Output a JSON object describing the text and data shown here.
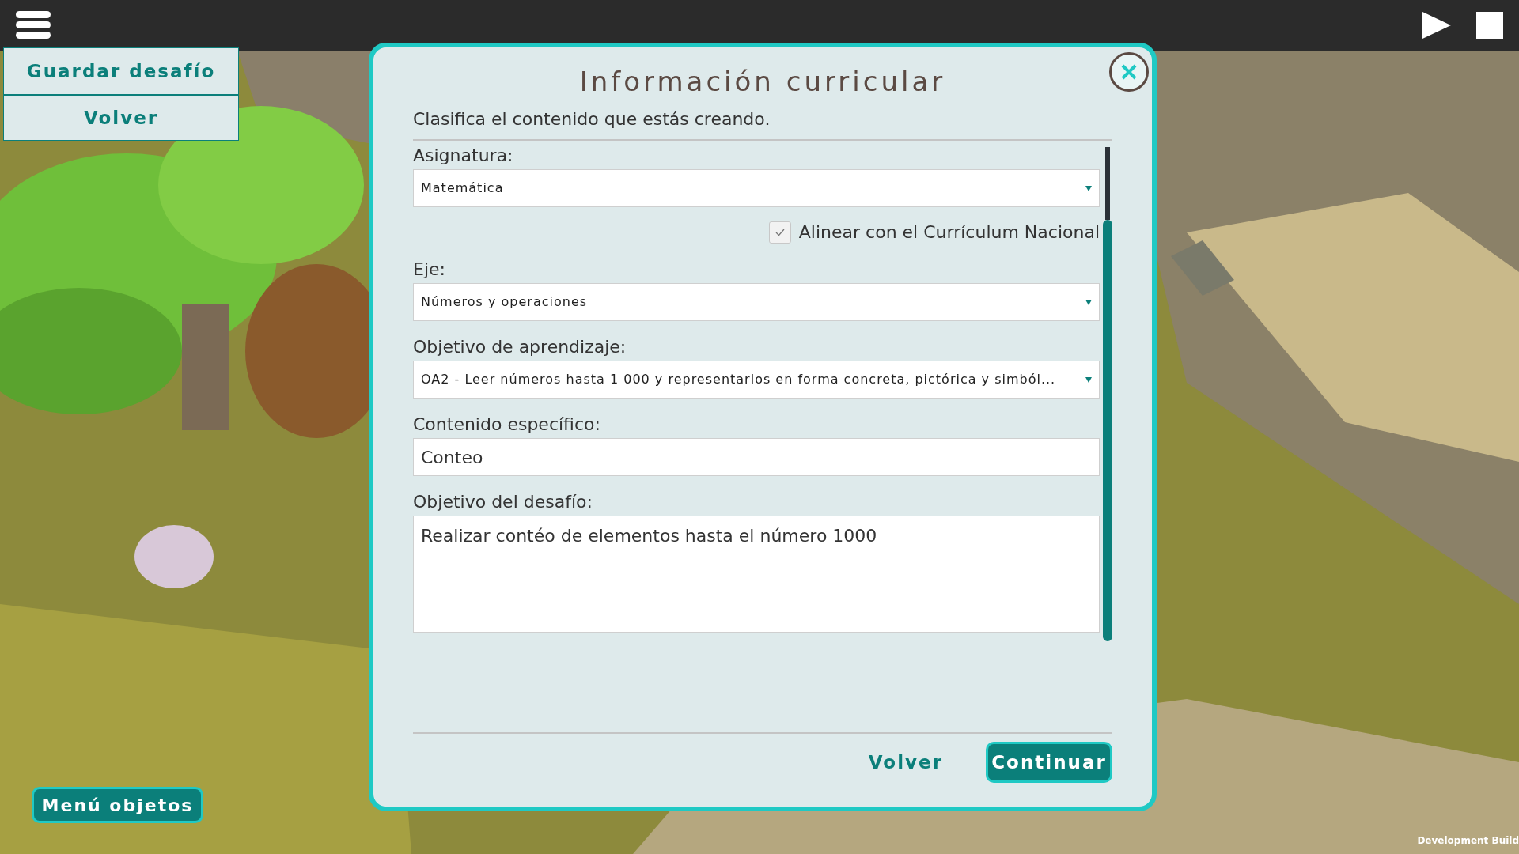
{
  "side_menu": {
    "items": [
      {
        "label": "Guardar desafío"
      },
      {
        "label": "Volver"
      }
    ]
  },
  "dialog": {
    "title": "Información curricular",
    "subtitle": "Clasifica el contenido que estás creando.",
    "fields": [
      {
        "kind": "select",
        "label": "Asignatura:",
        "value": "Matemática"
      },
      {
        "kind": "checkbox",
        "label": "Alinear con el Currículum Nacional",
        "checked": true
      },
      {
        "kind": "select",
        "label": "Eje:",
        "value": "Números y operaciones"
      },
      {
        "kind": "select",
        "label": "Objetivo de aprendizaje:",
        "value": "OA2 - Leer números hasta 1 000 y representarlos en forma concreta, pictórica y simból..."
      },
      {
        "kind": "text",
        "label": "Contenido específico:",
        "value": "Conteo"
      },
      {
        "kind": "textarea",
        "label": "Objetivo del desafío:",
        "value": "Realizar contéo de elementos hasta el número 1000"
      }
    ],
    "buttons": [
      {
        "kind": "link",
        "label": "Volver"
      },
      {
        "kind": "primary",
        "label": "Continuar"
      }
    ]
  },
  "objects_button": {
    "label": "Menú objetos"
  },
  "build_label": "Development Build"
}
